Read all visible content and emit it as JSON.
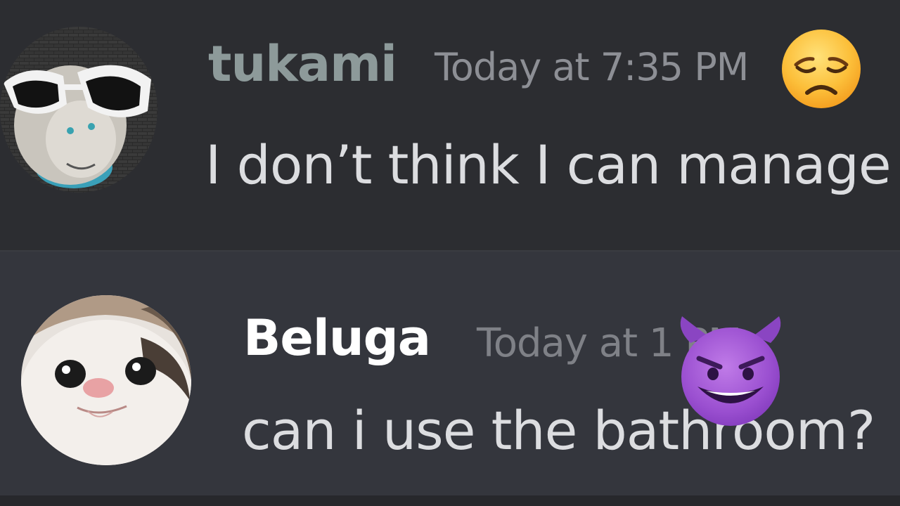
{
  "messages": [
    {
      "username": "tukami",
      "timestamp": "Today at 7:35 PM",
      "content": "I don’t think I can manage",
      "avatar_icon": "sheep-sunglasses-avatar",
      "reaction_icon": "disappointed-face-emoji",
      "username_color": "#8d9a9a"
    },
    {
      "username": "Beluga",
      "timestamp": "Today at 1  PM",
      "content": "can i use the bathroom?",
      "avatar_icon": "beluga-cat-avatar",
      "reaction_icon": "smiling-devil-emoji",
      "username_color": "#ffffff"
    }
  ],
  "colors": {
    "background": "#2c2d31",
    "highlight_background": "#34363d",
    "timestamp": "#8d8f95",
    "text": "#dcdde0"
  }
}
